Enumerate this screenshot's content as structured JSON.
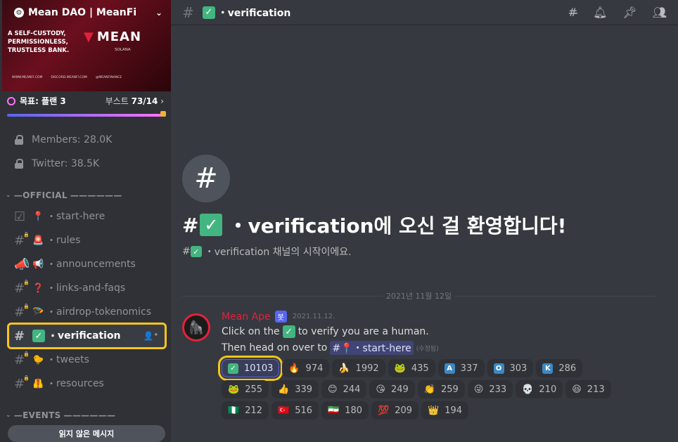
{
  "server": {
    "name": "Mean DAO | MeanFi",
    "chevron": "⌄"
  },
  "banner": {
    "tagline": "A SELF-CUSTODY, PERMISSIONLESS, TRUSTLESS BANK.",
    "logo": "MEAN",
    "logo_sub": "SOLANA",
    "links": [
      "WWW.MEANFI.COM",
      "DISCORD.MEANFI.COM",
      "@MEANFINANCE"
    ]
  },
  "boost": {
    "goal": "목표: 플랜 3",
    "label": "부스트",
    "count": "73/14",
    "progress": 1.0
  },
  "stats": [
    {
      "label": "Members: 28.0K"
    },
    {
      "label": "Twitter: 38.5K"
    }
  ],
  "categories": {
    "official": "OFFICIAL",
    "events": "EVENTS"
  },
  "channels": [
    {
      "emoji": "📍",
      "name": "start-here"
    },
    {
      "emoji": "🚨",
      "name": "rules"
    },
    {
      "emoji": "📢",
      "name": "announcements"
    },
    {
      "emoji": "❓",
      "name": "links-and-faqs"
    },
    {
      "emoji": "🪂",
      "name": "airdrop-tokenomics"
    },
    {
      "emoji": "✅",
      "name": "verification",
      "active": true
    },
    {
      "emoji": "🐤",
      "name": "tweets"
    },
    {
      "emoji": "🦺",
      "name": "resources"
    }
  ],
  "unread_label": "읽지 않은 메시지",
  "topbar": {
    "channel": "・verification"
  },
  "welcome": {
    "title": "・verification에 오신 걸 환영합니다!",
    "subtitle": "・verification 채널의 시작이에요."
  },
  "divider": {
    "date": "2021년 11월 12일"
  },
  "message": {
    "author": "Mean Ape",
    "bot_tag": "봇",
    "timestamp": "2021.11.12.",
    "line1_pre": "Click on the",
    "line1_post": "to verify you are a human.",
    "line2_pre": "Then head on over to",
    "mention": "・start-here",
    "edited": "(수정됨)"
  },
  "reactions": [
    {
      "emoji": "✅",
      "count": "10103",
      "me": true,
      "box": "#43b581",
      "symbol": "✓"
    },
    {
      "emoji": "🔥",
      "count": "974"
    },
    {
      "emoji": "🍌",
      "count": "1992"
    },
    {
      "emoji": "🐸",
      "count": "435"
    },
    {
      "emoji": "A",
      "count": "337",
      "box": "#3b88c3"
    },
    {
      "emoji": "O",
      "count": "303",
      "box": "#3b88c3"
    },
    {
      "emoji": "K",
      "count": "286",
      "box": "#3b88c3"
    },
    {
      "emoji": "🐸",
      "count": "255"
    },
    {
      "emoji": "👍",
      "count": "339"
    },
    {
      "emoji": "😊",
      "count": "244"
    },
    {
      "emoji": "😘",
      "count": "249"
    },
    {
      "emoji": "👏",
      "count": "259"
    },
    {
      "emoji": "😜",
      "count": "233"
    },
    {
      "emoji": "💀",
      "count": "210"
    },
    {
      "emoji": "😆",
      "count": "213"
    },
    {
      "emoji": "🇳🇬",
      "count": "212"
    },
    {
      "emoji": "🇹🇷",
      "count": "516"
    },
    {
      "emoji": "🇮🇷",
      "count": "180"
    },
    {
      "emoji": "💯",
      "count": "209"
    },
    {
      "emoji": "👑",
      "count": "194"
    }
  ]
}
